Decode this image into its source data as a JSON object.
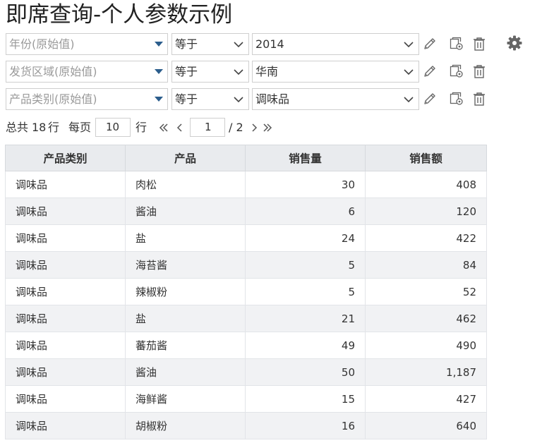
{
  "page": {
    "title": "即席查询-个人参数示例"
  },
  "filters": [
    {
      "field_placeholder": "年份(原始值)",
      "operator": "等于",
      "value": "2014"
    },
    {
      "field_placeholder": "发货区域(原始值)",
      "operator": "等于",
      "value": "华南"
    },
    {
      "field_placeholder": "产品类别(原始值)",
      "operator": "等于",
      "value": "调味品"
    }
  ],
  "pager": {
    "total_prefix": "总共",
    "total_count": "18",
    "total_suffix": "行",
    "per_page_label": "每页",
    "per_page_value": "10",
    "per_page_suffix": "行",
    "current_page": "1",
    "total_pages": "/ 2"
  },
  "table": {
    "columns": [
      "产品类别",
      "产品",
      "销售量",
      "销售额"
    ],
    "rows": [
      [
        "调味品",
        "肉松",
        "30",
        "408"
      ],
      [
        "调味品",
        "酱油",
        "6",
        "120"
      ],
      [
        "调味品",
        "盐",
        "24",
        "422"
      ],
      [
        "调味品",
        "海苔酱",
        "5",
        "84"
      ],
      [
        "调味品",
        "辣椒粉",
        "5",
        "52"
      ],
      [
        "调味品",
        "盐",
        "21",
        "462"
      ],
      [
        "调味品",
        "蕃茄酱",
        "49",
        "490"
      ],
      [
        "调味品",
        "酱油",
        "50",
        "1,187"
      ],
      [
        "调味品",
        "海鲜酱",
        "15",
        "427"
      ],
      [
        "调味品",
        "胡椒粉",
        "16",
        "640"
      ]
    ]
  },
  "icons": {
    "edit": "pencil-icon",
    "copy": "copy-settings-icon",
    "delete": "trash-icon",
    "settings": "gear-icon",
    "dropdown": "dropdown-triangle-icon",
    "chevron": "chevron-down-icon"
  },
  "colors": {
    "triangle": "#2b5d8c",
    "header_bg": "#e9ebee",
    "alt_row": "#f1f2f4",
    "icon": "#666666"
  }
}
